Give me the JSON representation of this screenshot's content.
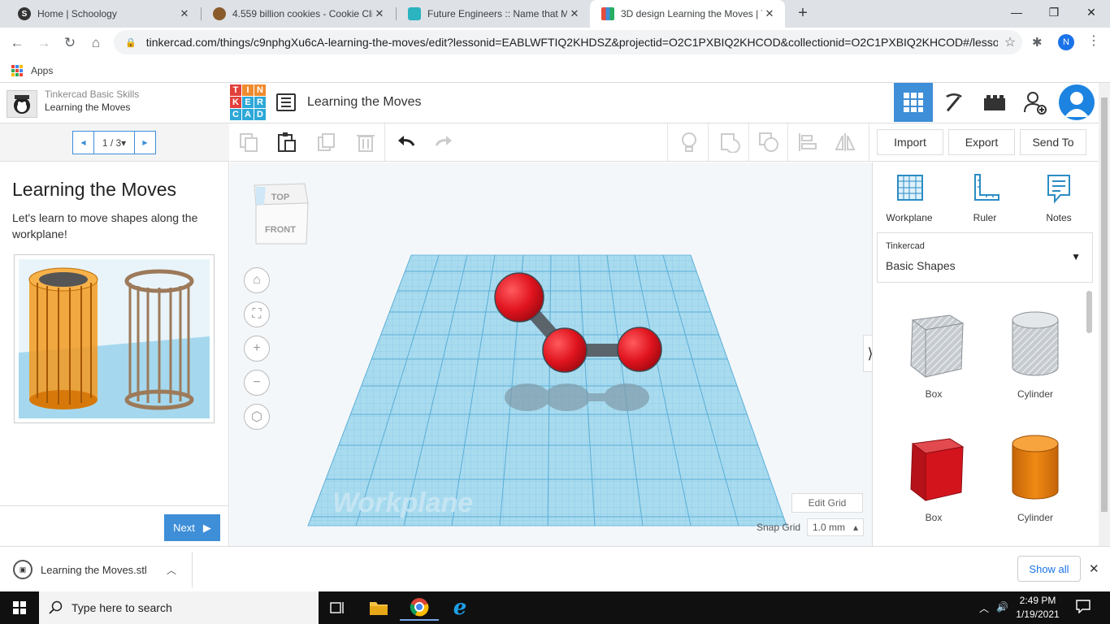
{
  "browser": {
    "tabs": [
      {
        "title": "Home | Schoology",
        "favicon": "S"
      },
      {
        "title": "4.559 billion cookies - Cookie Clic",
        "favicon": "cookie"
      },
      {
        "title": "Future Engineers :: Name that Mo",
        "favicon": "fe"
      },
      {
        "title": "3D design Learning the Moves | T",
        "favicon": "tinkercad"
      }
    ],
    "new_tab": "+",
    "url": "tinkercad.com/things/c9nphgXu6cA-learning-the-moves/edit?lessonid=EABLWFTIQ2KHDSZ&projectid=O2C1PXBIQ2KHCOD&collectionid=O2C1PXBIQ2KHCOD#/lesso...",
    "profile_initial": "N",
    "bookmarks_apps": "Apps"
  },
  "lesson": {
    "course": "Tinkercad Basic Skills",
    "name": "Learning the Moves",
    "pager": "1 / 3▾",
    "heading": "Learning the Moves",
    "description": "Let's learn to move shapes along the workplane!",
    "next_label": "Next"
  },
  "header": {
    "logo_letters": [
      "T",
      "I",
      "N",
      "K",
      "E",
      "R",
      "C",
      "A",
      "D"
    ],
    "design_title": "Learning the Moves"
  },
  "toolbar": {
    "import_label": "Import",
    "export_label": "Export",
    "sendto_label": "Send To"
  },
  "viewport": {
    "viewcube_top": "TOP",
    "viewcube_front": "FRONT",
    "workplane_label": "Workplane",
    "edit_grid_label": "Edit Grid",
    "snap_grid_label": "Snap Grid",
    "snap_grid_value": "1.0 mm"
  },
  "shapes_panel": {
    "tools": [
      "Workplane",
      "Ruler",
      "Notes"
    ],
    "library_small": "Tinkercad",
    "library_name": "Basic Shapes",
    "shapes": [
      {
        "label": "Box",
        "variant": "hole"
      },
      {
        "label": "Cylinder",
        "variant": "hole"
      },
      {
        "label": "Box",
        "variant": "red"
      },
      {
        "label": "Cylinder",
        "variant": "orange"
      }
    ]
  },
  "download": {
    "file": "Learning the Moves.stl",
    "show_all": "Show all"
  },
  "taskbar": {
    "search_placeholder": "Type here to search",
    "time": "2:49 PM",
    "date": "1/19/2021"
  },
  "colors": {
    "tinkercad_blue": "#3e8ed8",
    "atom_red": "#e0141e",
    "bond_gray": "#555c63",
    "workplane_blue": "#9fd3ea"
  }
}
